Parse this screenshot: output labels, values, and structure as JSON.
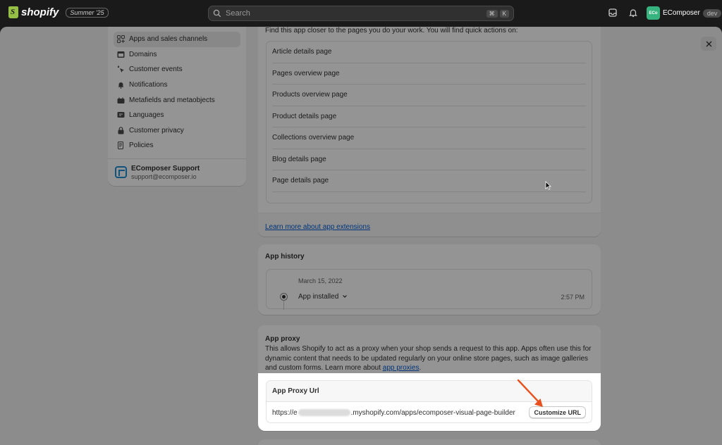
{
  "topbar": {
    "logo_text": "shopify",
    "badge": "Summer '25",
    "search_placeholder": "Search",
    "shortcut_1": "⌘",
    "shortcut_2": "K",
    "store_initials": "ECo",
    "store_name": "EComposer",
    "store_badge": "dev"
  },
  "sidebar": {
    "items": [
      {
        "label": "Apps and sales channels",
        "icon": "apps-icon"
      },
      {
        "label": "Domains",
        "icon": "domains-icon"
      },
      {
        "label": "Customer events",
        "icon": "cursor-click-icon"
      },
      {
        "label": "Notifications",
        "icon": "bell-icon"
      },
      {
        "label": "Metafields and metaobjects",
        "icon": "metafields-icon"
      },
      {
        "label": "Languages",
        "icon": "languages-icon"
      },
      {
        "label": "Customer privacy",
        "icon": "lock-icon"
      },
      {
        "label": "Policies",
        "icon": "policies-icon"
      }
    ],
    "support": {
      "name": "EComposer Support",
      "email": "support@ecomposer.io"
    }
  },
  "extensions": {
    "description": "Find this app closer to the pages you do your work. You will find quick actions on:",
    "pages": [
      "Article details page",
      "Pages overview page",
      "Products overview page",
      "Product details page",
      "Collections overview page",
      "Blog details page",
      "Page details page"
    ],
    "learn_more": "Learn more about app extensions"
  },
  "history": {
    "title": "App history",
    "date": "March 15, 2022",
    "event": "App installed",
    "time": "2:57 PM"
  },
  "proxy": {
    "title": "App proxy",
    "description": "This allows Shopify to act as a proxy when your shop sends a request to this app. Apps often use this for dynamic content that needs to be updated regularly on your online store pages, such as image galleries and custom forms. Learn more about",
    "link_text": "app proxies",
    "box_title": "App Proxy Url",
    "url_prefix": "https://e",
    "url_suffix": ".myshopify.com/apps/ecomposer-visual-page-builder",
    "button_label": "Customize URL"
  },
  "colors": {
    "accent_link": "#005bd3",
    "arrow": "#e8501e",
    "store_avatar": "#36b37e"
  }
}
